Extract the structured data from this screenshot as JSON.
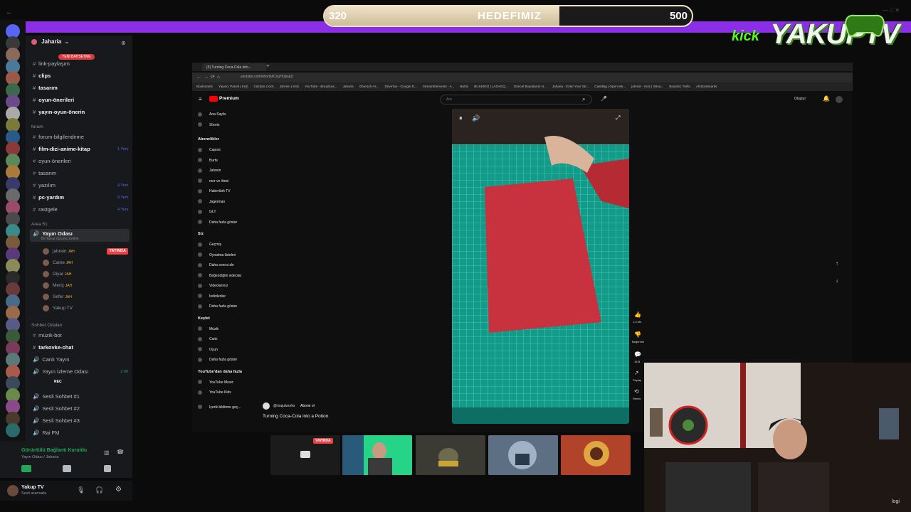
{
  "goal": {
    "current": "320",
    "label": "HEDEFIMIZ",
    "target": "500",
    "progress": 0.64
  },
  "logos": {
    "kick": "kick",
    "yakup": "YAKUPTV"
  },
  "discord": {
    "server_name": "Jaharia",
    "new_badge": "YENİ BAHSETME",
    "channels_top": [
      {
        "label": "link-paylaşım",
        "bold": false
      },
      {
        "label": "clips",
        "bold": true
      },
      {
        "label": "tasarım",
        "bold": true
      },
      {
        "label": "oyun-önerileri",
        "bold": true
      },
      {
        "label": "yayın-oyun-önerin",
        "bold": true
      }
    ],
    "cat_forum": "forum",
    "forum_channels": [
      {
        "label": "forum-bilgilendirme",
        "bold": false,
        "count": ""
      },
      {
        "label": "film-dizi-anime-kitap",
        "bold": true,
        "count": "1 Yeni"
      },
      {
        "label": "oyun-önerileri",
        "bold": false,
        "count": ""
      },
      {
        "label": "tasarım",
        "bold": false,
        "count": ""
      },
      {
        "label": "yazılım",
        "bold": false,
        "count": "4 Yeni"
      },
      {
        "label": "pc-yardım",
        "bold": true,
        "count": "9 Yeni"
      },
      {
        "label": "rastgele",
        "bold": false,
        "count": "4 Yeni"
      }
    ],
    "cat_area": "Area 51",
    "voice_room": "Yayın Odası",
    "voice_room_sub": "Bir kanal durumu belirle",
    "live_label": "YAYINDA",
    "voice_users": [
      {
        "name": "jahrein",
        "tag": "JAH"
      },
      {
        "name": "Caine",
        "tag": "JAH"
      },
      {
        "name": "Diyar",
        "tag": "JAH"
      },
      {
        "name": "Meriç",
        "tag": "JAH"
      },
      {
        "name": "Sefer",
        "tag": "JAH"
      },
      {
        "name": "Yakup TV",
        "tag": ""
      }
    ],
    "cat_chat": "Sohbet Odaları",
    "chat_channels": [
      {
        "label": "müzik-bot",
        "bold": false
      },
      {
        "label": "tarkovke-chat",
        "bold": true
      },
      {
        "label": "Canlı Yayın",
        "bold": false
      },
      {
        "label": "Yayın İzleme Odası",
        "bold": false
      }
    ],
    "watch_time": "2:30",
    "rec_label": "REC",
    "voice_channels": [
      "Sesli Sohbet #1",
      "Sesli Sohbet #2",
      "Sesli Sohbet #3",
      "Rai FM"
    ],
    "connection_status": "Görüntülü Bağlantı Kuruldu",
    "connection_sub": "Yayın Odası / Jaharia",
    "user_name": "Yakup TV",
    "user_status": "Sesli aramada"
  },
  "browser": {
    "tab_title": "(5) Turning Coca-Cola into...",
    "url": "youtube.com/shorts/lCnuHUpsjUI",
    "bookmarks": [
      "Bookmarks",
      "Yayıncı Paneli | Kick",
      "Cüzdan | Kick",
      "Jahrein | Kick",
      "YouTube - Broadcas...",
      "Jaharia",
      "Obursoh As...",
      "Drive'ları - Google D...",
      "StreamElements - A...",
      "Botrix",
      "BUSHIDO | LASAGQ...",
      "Güncel Boyutlarım N...",
      "Jaharia - Enter Your Str...",
      "Castillag | Open Me...",
      "jahrein - Kick | Strea...",
      "Boards | Trello",
      "All Bookmarks"
    ],
    "search_placeholder": "Ara",
    "yt_premium": "Premium",
    "sign_in": "Oluştur",
    "side_main": [
      "Ana Sayfa",
      "Shorts"
    ],
    "subs_head": "Abonelikler",
    "subs": [
      "Caposi",
      "Burhi",
      "Jahrein",
      "mor ve ötesi",
      "Habertürk TV",
      "Jagerman",
      "GLY"
    ],
    "show_more": "Daha fazla göster",
    "you_head": "Siz",
    "you_items": [
      "Geçmiş",
      "Oynatma listeleri",
      "Daha sonra izle",
      "Beğendiğim videolar",
      "Videolarınız",
      "İndirilenler"
    ],
    "explore_head": "Keşfet",
    "explore_items": [
      "Müzik",
      "Canlı",
      "Oyun"
    ],
    "more_head": "YouTube'dan daha fazla",
    "more_items": [
      "YouTube Music",
      "YouTube Kids"
    ],
    "footer": "İçerik bildirme geç...",
    "channel_handle": "@majutworks",
    "subscribe": "Abone ol",
    "video_title": "Turning Coca-Cola into a Potion.",
    "likes": "1,3 Mn",
    "dislike_label": "Beğenme",
    "comments": "16 B",
    "share_label": "Paylaş",
    "remix_label": "Remix"
  },
  "thumbs": {
    "live_label": "YAYINDA"
  }
}
